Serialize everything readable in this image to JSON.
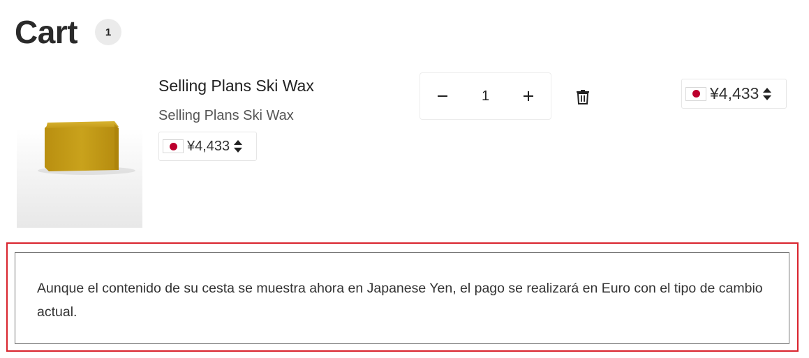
{
  "header": {
    "title": "Cart",
    "item_count": "1"
  },
  "cart": {
    "items": [
      {
        "name": "Selling Plans Ski Wax",
        "variant": "Selling Plans Ski Wax",
        "unit_price": "¥4,433",
        "quantity": "1",
        "line_total": "¥4,433",
        "currency_flag_icon": "japan-flag-icon",
        "image_icon": "ski-wax-bar-image",
        "wax_color": "#c9a21c"
      }
    ],
    "quantity_minus_icon": "minus-icon",
    "quantity_plus_icon": "plus-icon",
    "remove_icon": "trash-icon"
  },
  "notice": {
    "text": "Aunque el contenido de su cesta se muestra ahora en Japanese Yen, el pago se realizará en Euro con el tipo de cambio actual.",
    "highlight_color": "#d9232d"
  }
}
